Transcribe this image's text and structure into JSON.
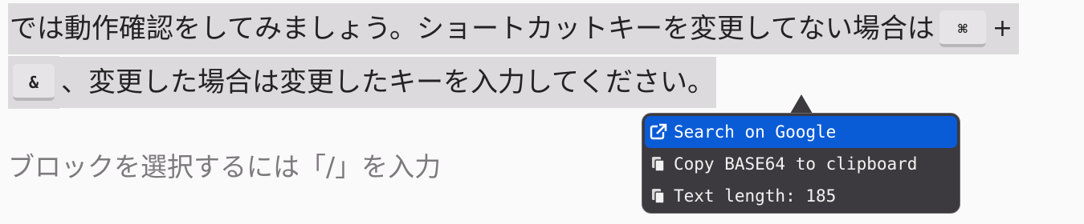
{
  "editor": {
    "line1_text": "では動作確認をしてみましょう。ショートカットキーを変更してない場合は",
    "key_cmd": "⌘",
    "plus": "+",
    "key_amp": "&",
    "line2_text": "、変更した場合は変更したキーを入力してください。",
    "placeholder": "ブロックを選択するには「/」を入力"
  },
  "popup": {
    "items": [
      {
        "label": "Search on Google",
        "icon": "external-link-icon",
        "active": true
      },
      {
        "label": "Copy BASE64 to clipboard",
        "icon": "copy-icon",
        "active": false
      },
      {
        "label": "Text length: 185",
        "icon": "copy-icon",
        "active": false
      }
    ]
  },
  "colors": {
    "selection": "#dddadd",
    "popup_bg": "#3c3a3f",
    "active_item": "#0a5bd6"
  }
}
